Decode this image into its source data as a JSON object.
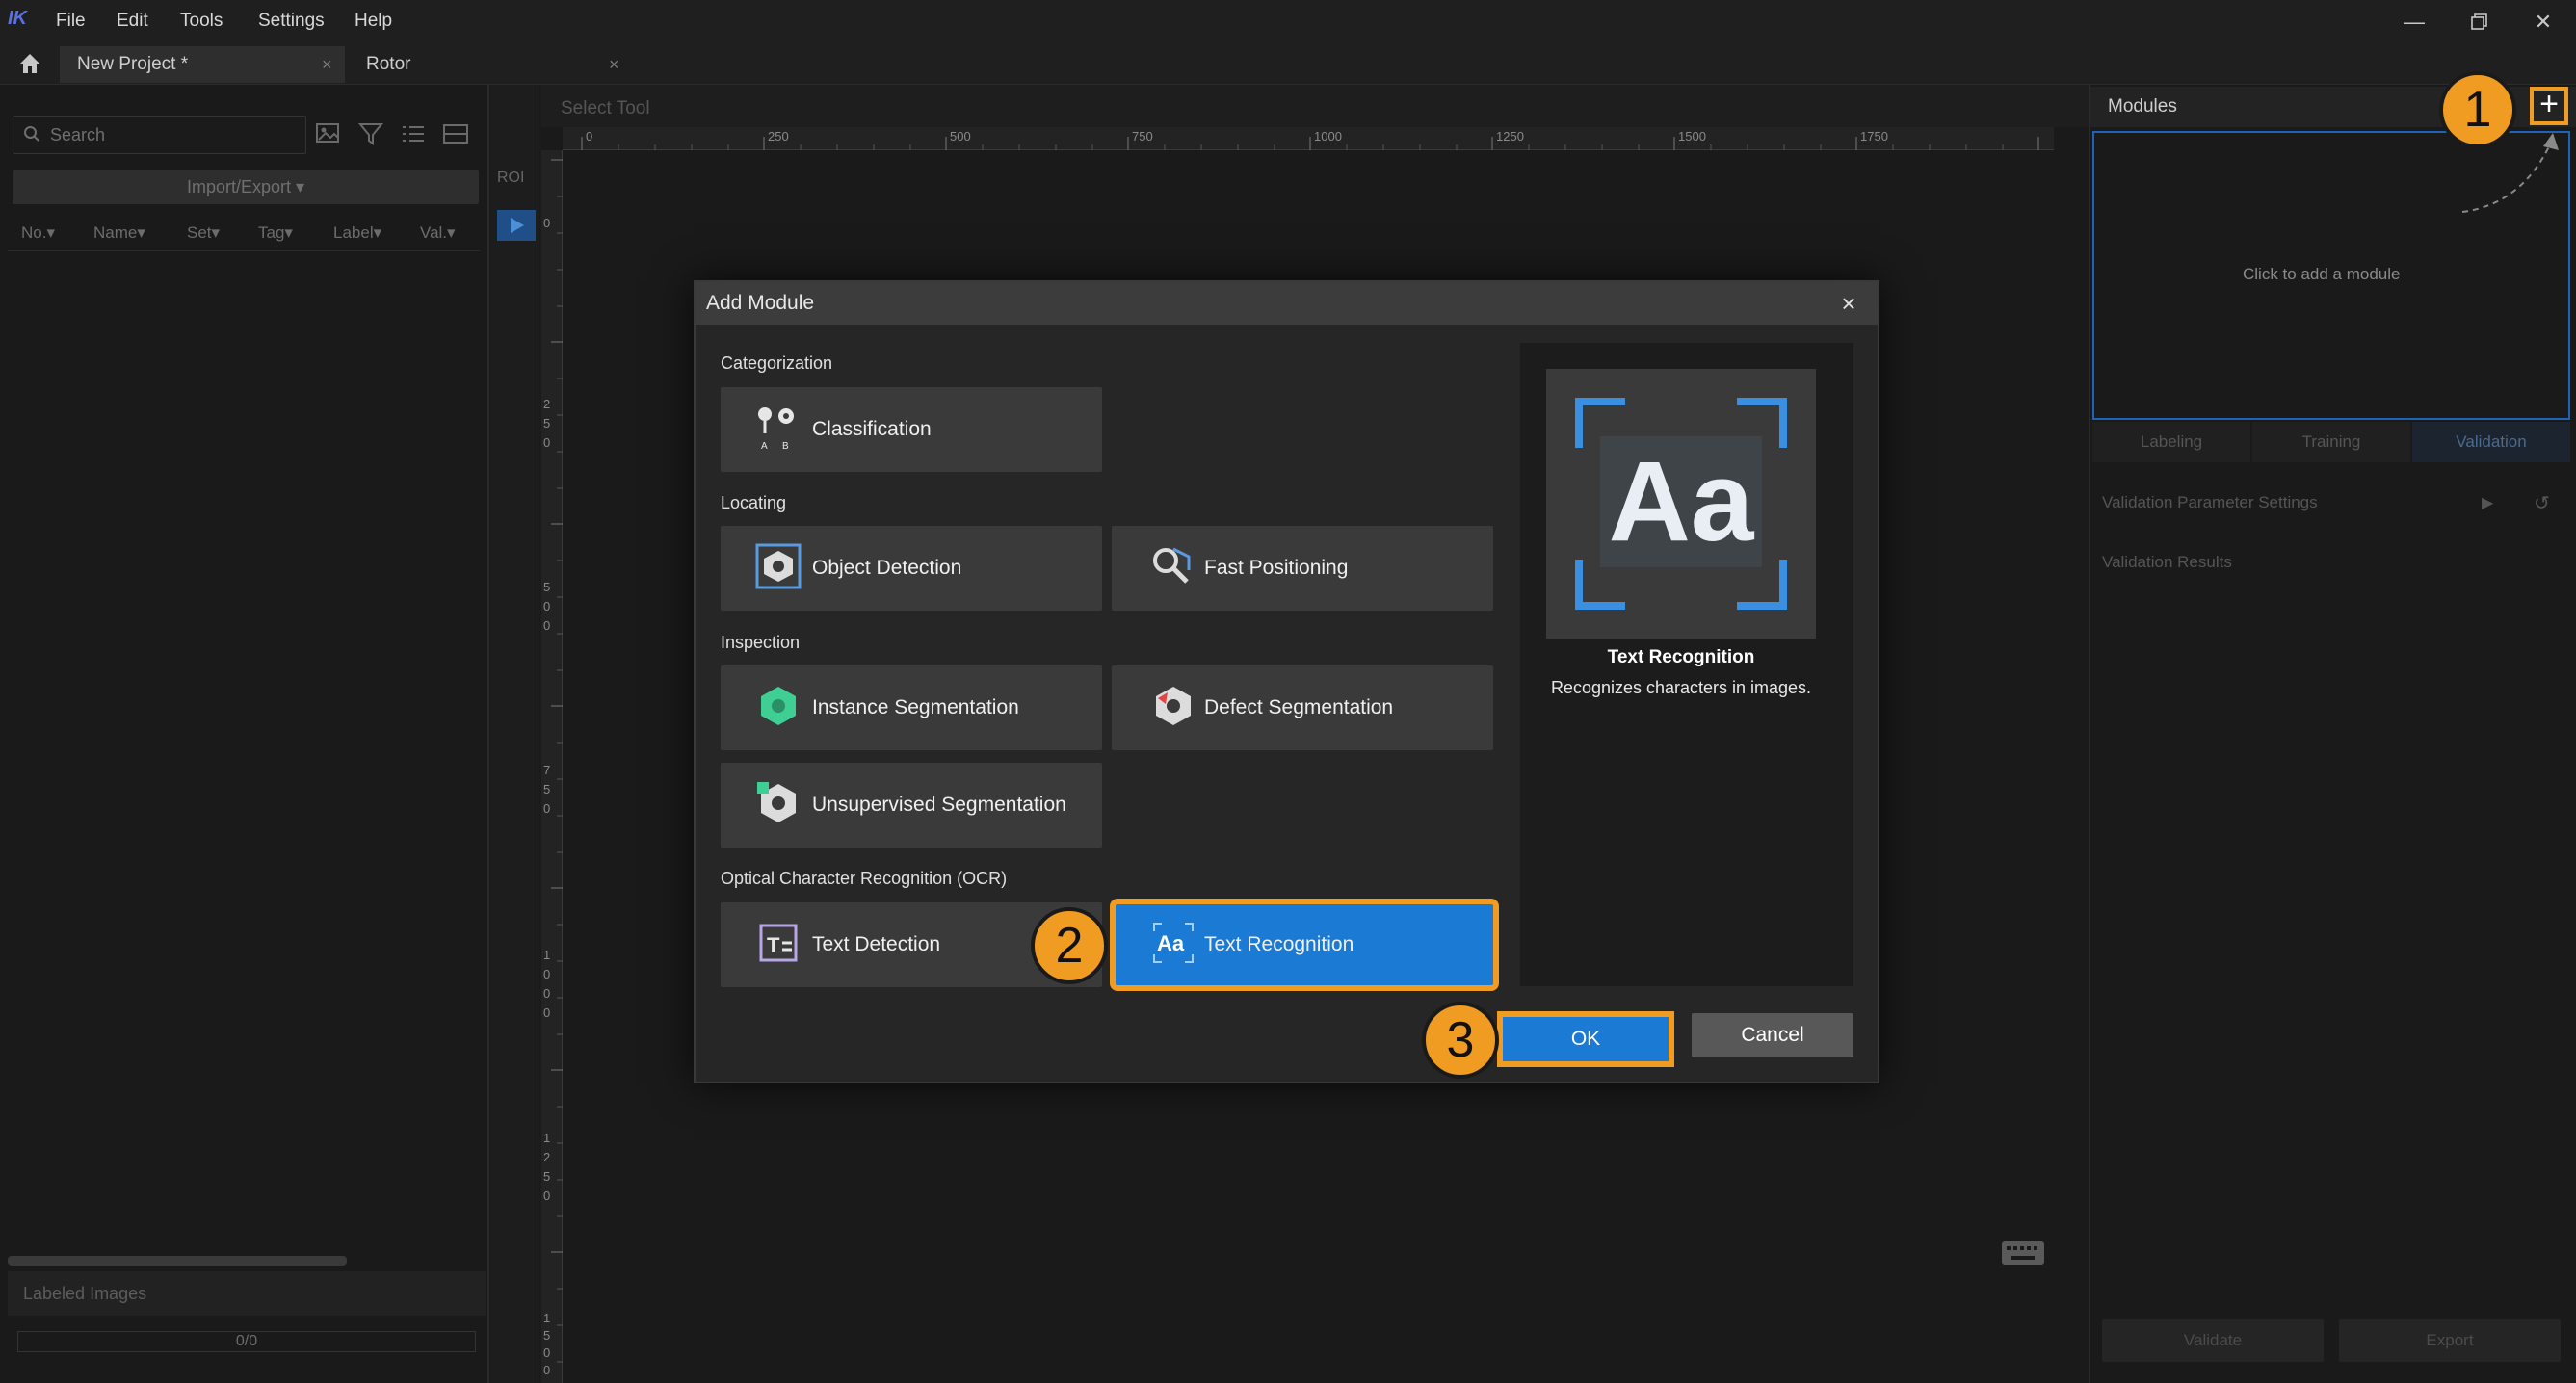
{
  "menu": {
    "items": [
      "File",
      "Edit",
      "Tools",
      "Settings",
      "Help"
    ]
  },
  "tabs": [
    {
      "label": "New Project *"
    },
    {
      "label": "Rotor"
    }
  ],
  "left_panel": {
    "search_placeholder": "Search",
    "import_export_label": "Import/Export ▾",
    "columns": [
      "No.▾",
      "Name▾",
      "Set▾",
      "Tag▾",
      "Label▾",
      "Val.▾"
    ],
    "labeled_images": "Labeled Images",
    "counter": "0/0"
  },
  "toolstrip": {
    "roi_label": "ROI"
  },
  "canvas": {
    "select_tool": "Select Tool",
    "ruler_h": [
      "0",
      "250",
      "500",
      "750",
      "1000",
      "1250",
      "1500",
      "1750"
    ],
    "ruler_v": [
      "0",
      "2 5 0",
      "5 0 0",
      "7 5 0",
      "1 0 0 0",
      "1 2 5 0",
      "1 5 0 0"
    ]
  },
  "right_panel": {
    "title": "Modules",
    "add_symbol": "+",
    "hint": "Click to add a module",
    "tabs": [
      "Labeling",
      "Training",
      "Validation"
    ],
    "row1": "Validation Parameter Settings",
    "row2": "Validation Results",
    "validate": "Validate",
    "export": "Export"
  },
  "callouts": [
    "1",
    "2",
    "3"
  ],
  "dialog": {
    "title": "Add Module",
    "close": "×",
    "categories": {
      "categorization": "Categorization",
      "locating": "Locating",
      "inspection": "Inspection",
      "ocr": "Optical Character Recognition (OCR)"
    },
    "modules": {
      "classification": "Classification",
      "object_detection": "Object Detection",
      "fast_positioning": "Fast Positioning",
      "instance_segmentation": "Instance Segmentation",
      "defect_segmentation": "Defect Segmentation",
      "unsupervised_segmentation": "Unsupervised Segmentation",
      "text_detection": "Text Detection",
      "text_recognition": "Text Recognition"
    },
    "preview": {
      "image_text": "Aa",
      "title": "Text Recognition",
      "description": "Recognizes characters in images."
    },
    "ok": "OK",
    "cancel": "Cancel"
  },
  "colors": {
    "accent_blue": "#1a7ad4",
    "callout_orange": "#f09b22"
  }
}
